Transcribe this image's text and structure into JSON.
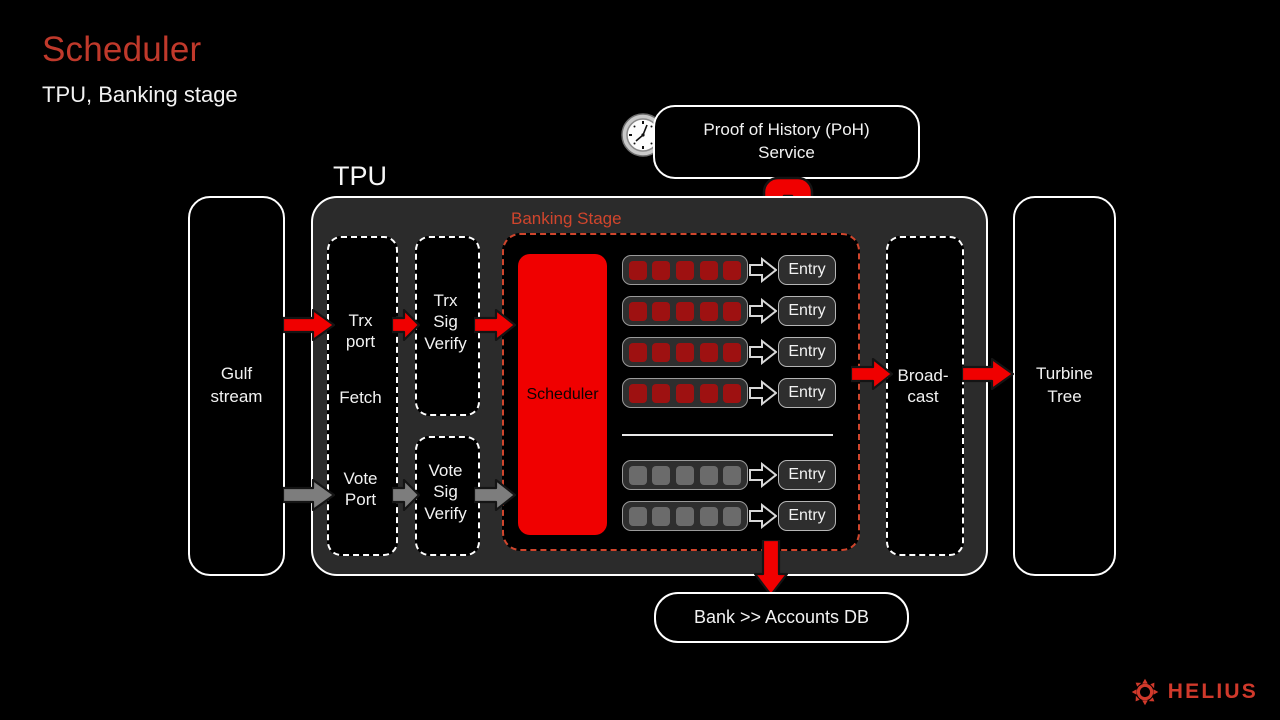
{
  "slide": {
    "title": "Scheduler",
    "subtitle": "TPU, Banking stage",
    "title_color": "#C0392B"
  },
  "brand": {
    "name": "HELIUS",
    "icon": "helius-sunburst-icon",
    "color": "#D0392B"
  },
  "diagram": {
    "gulf_stream": {
      "label": "Gulf\nstream",
      "line1": "Gulf",
      "line2": "stream"
    },
    "tpu": {
      "label": "TPU",
      "fetch_stage": {
        "name": "fetch-stage",
        "trx_port": "Trx\nport",
        "trx_port_line1": "Trx",
        "trx_port_line2": "port",
        "fetch": "Fetch",
        "vote_port_line1": "Vote",
        "vote_port_line2": "Port"
      },
      "trx_sig_verify": {
        "line1": "Trx",
        "line2": "Sig",
        "line3": "Verify"
      },
      "vote_sig_verify": {
        "line1": "Vote",
        "line2": "Sig",
        "line3": "Verify"
      },
      "broadcast": {
        "line1": "Broad-",
        "line2": "cast"
      }
    },
    "banking_stage": {
      "label": "Banking Stage",
      "label_color": "#D0452C",
      "border_color": "#D0452C",
      "scheduler": {
        "label": "Scheduler",
        "color": "#F00000"
      },
      "entry_label": "Entry",
      "trx_rows": [
        {
          "cells": 5,
          "cell_color": "#9E1111",
          "entry": "Entry"
        },
        {
          "cells": 5,
          "cell_color": "#9E1111",
          "entry": "Entry"
        },
        {
          "cells": 5,
          "cell_color": "#9E1111",
          "entry": "Entry"
        },
        {
          "cells": 5,
          "cell_color": "#9E1111",
          "entry": "Entry"
        }
      ],
      "vote_rows": [
        {
          "cells": 5,
          "cell_color": "#6b6b6b",
          "entry": "Entry"
        },
        {
          "cells": 5,
          "cell_color": "#6b6b6b",
          "entry": "Entry"
        }
      ]
    },
    "poh_service": {
      "line1": "Proof of History (PoH)",
      "line2": "Service",
      "icon": "clock-icon"
    },
    "bank_db": {
      "label": "Bank >> Accounts DB"
    },
    "turbine_tree": {
      "line1": "Turbine",
      "line2": "Tree"
    },
    "arrow_colors": {
      "transaction": "#F00000",
      "vote": "#7d7d7d"
    }
  }
}
